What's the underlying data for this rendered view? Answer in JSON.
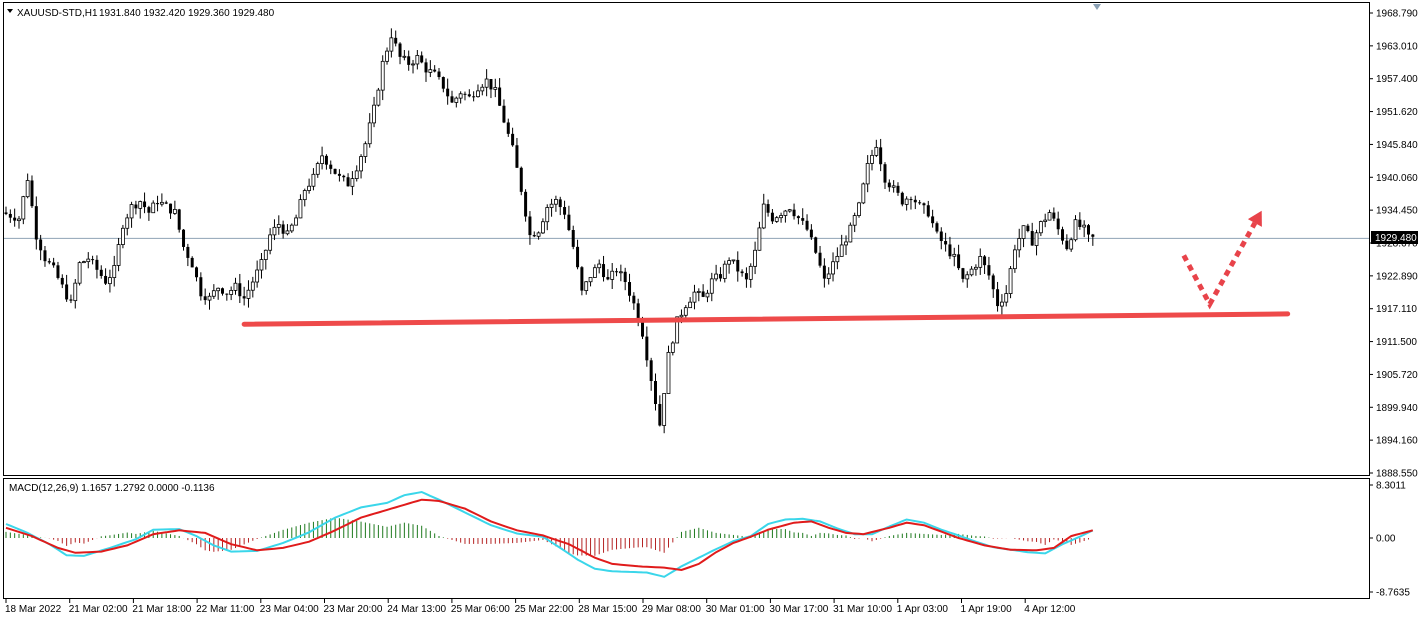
{
  "header": {
    "symbol": "XAUUSD-STD,H1",
    "ohlc": "1931.840 1932.420 1929.360 1929.480"
  },
  "macd_header": "MACD(12,26,9) 1.1657 1.2792 0.0000 -0.1136",
  "current_price_label": "1929.480",
  "chart_data": {
    "type": "candlestick",
    "price_axis": {
      "ticks": [
        "1968.790",
        "1963.010",
        "1957.400",
        "1951.620",
        "1945.840",
        "1940.060",
        "1934.450",
        "1928.670",
        "1922.890",
        "1917.110",
        "1911.500",
        "1905.720",
        "1899.940",
        "1894.160",
        "1888.550"
      ],
      "range": [
        1888.55,
        1968.79
      ],
      "current": 1929.48
    },
    "macd_axis": {
      "ticks": [
        "8.3011",
        "0.00",
        "-8.7635"
      ],
      "range": [
        -8.7635,
        8.3011
      ]
    },
    "time_axis": [
      "18 Mar 2022",
      "21 Mar 02:00",
      "21 Mar 18:00",
      "22 Mar 11:00",
      "23 Mar 04:00",
      "23 Mar 20:00",
      "24 Mar 13:00",
      "25 Mar 06:00",
      "25 Mar 22:00",
      "28 Mar 15:00",
      "29 Mar 08:00",
      "30 Mar 01:00",
      "30 Mar 17:00",
      "31 Mar 10:00",
      "1 Apr 03:00",
      "1 Apr 19:00",
      "4 Apr 12:00"
    ],
    "price_path": [
      [
        0,
        1934
      ],
      [
        4,
        1933
      ],
      [
        6,
        1940
      ],
      [
        8,
        1930
      ],
      [
        10,
        1926
      ],
      [
        12,
        1924
      ],
      [
        14,
        1921
      ],
      [
        16,
        1918
      ],
      [
        18,
        1925
      ],
      [
        20,
        1926
      ],
      [
        22,
        1924
      ],
      [
        24,
        1922
      ],
      [
        26,
        1924
      ],
      [
        28,
        1932
      ],
      [
        30,
        1935
      ],
      [
        32,
        1936
      ],
      [
        34,
        1934
      ],
      [
        36,
        1936
      ],
      [
        38,
        1935
      ],
      [
        40,
        1934
      ],
      [
        42,
        1928
      ],
      [
        44,
        1925
      ],
      [
        46,
        1920
      ],
      [
        48,
        1919
      ],
      [
        50,
        1921
      ],
      [
        52,
        1920
      ],
      [
        54,
        1921
      ],
      [
        56,
        1919
      ],
      [
        58,
        1922
      ],
      [
        60,
        1925
      ],
      [
        62,
        1930
      ],
      [
        64,
        1932
      ],
      [
        66,
        1930
      ],
      [
        68,
        1933
      ],
      [
        70,
        1938
      ],
      [
        72,
        1940
      ],
      [
        74,
        1944
      ],
      [
        76,
        1942
      ],
      [
        78,
        1940
      ],
      [
        80,
        1939
      ],
      [
        82,
        1942
      ],
      [
        84,
        1946
      ],
      [
        86,
        1952
      ],
      [
        88,
        1960
      ],
      [
        90,
        1965
      ],
      [
        92,
        1961
      ],
      [
        94,
        1960
      ],
      [
        96,
        1961
      ],
      [
        98,
        1959
      ],
      [
        100,
        1958
      ],
      [
        102,
        1956
      ],
      [
        104,
        1953
      ],
      [
        106,
        1955
      ],
      [
        108,
        1954
      ],
      [
        110,
        1956
      ],
      [
        112,
        1957
      ],
      [
        114,
        1955
      ],
      [
        116,
        1950
      ],
      [
        118,
        1945
      ],
      [
        120,
        1938
      ],
      [
        122,
        1930
      ],
      [
        124,
        1931
      ],
      [
        126,
        1935
      ],
      [
        128,
        1936
      ],
      [
        130,
        1934
      ],
      [
        132,
        1928
      ],
      [
        134,
        1920
      ],
      [
        136,
        1923
      ],
      [
        138,
        1925
      ],
      [
        140,
        1922
      ],
      [
        142,
        1924
      ],
      [
        144,
        1922
      ],
      [
        146,
        1918
      ],
      [
        148,
        1913
      ],
      [
        150,
        1905
      ],
      [
        152,
        1897
      ],
      [
        154,
        1909
      ],
      [
        156,
        1915
      ],
      [
        158,
        1918
      ],
      [
        160,
        1920
      ],
      [
        162,
        1919
      ],
      [
        164,
        1922
      ],
      [
        166,
        1923
      ],
      [
        168,
        1926
      ],
      [
        170,
        1924
      ],
      [
        172,
        1922
      ],
      [
        174,
        1927
      ],
      [
        176,
        1935
      ],
      [
        178,
        1933
      ],
      [
        180,
        1934
      ],
      [
        182,
        1935
      ],
      [
        184,
        1933
      ],
      [
        186,
        1931
      ],
      [
        188,
        1927
      ],
      [
        190,
        1922
      ],
      [
        192,
        1925
      ],
      [
        194,
        1928
      ],
      [
        196,
        1931
      ],
      [
        198,
        1935
      ],
      [
        200,
        1942
      ],
      [
        202,
        1946
      ],
      [
        204,
        1940
      ],
      [
        206,
        1938
      ],
      [
        208,
        1936
      ],
      [
        210,
        1937
      ],
      [
        212,
        1935
      ],
      [
        214,
        1934
      ],
      [
        216,
        1930
      ],
      [
        218,
        1928
      ],
      [
        220,
        1926
      ],
      [
        222,
        1922
      ],
      [
        224,
        1924
      ],
      [
        226,
        1926
      ],
      [
        228,
        1923
      ],
      [
        230,
        1918
      ],
      [
        232,
        1920
      ],
      [
        234,
        1928
      ],
      [
        236,
        1931
      ],
      [
        238,
        1929
      ],
      [
        240,
        1932
      ],
      [
        242,
        1934
      ],
      [
        244,
        1931
      ],
      [
        246,
        1928
      ],
      [
        248,
        1932
      ],
      [
        250,
        1931
      ],
      [
        251,
        1929.48
      ]
    ],
    "macd_path": [
      [
        0,
        2.2
      ],
      [
        5,
        0.8
      ],
      [
        10,
        -1.0
      ],
      [
        14,
        -2.8
      ],
      [
        18,
        -2.9
      ],
      [
        24,
        -1.6
      ],
      [
        30,
        -0.2
      ],
      [
        34,
        1.3
      ],
      [
        40,
        1.4
      ],
      [
        44,
        0.3
      ],
      [
        48,
        -1.2
      ],
      [
        52,
        -2.2
      ],
      [
        58,
        -2.1
      ],
      [
        64,
        -0.8
      ],
      [
        70,
        0.9
      ],
      [
        76,
        3.2
      ],
      [
        82,
        4.8
      ],
      [
        88,
        5.5
      ],
      [
        92,
        6.7
      ],
      [
        96,
        7.2
      ],
      [
        100,
        6.0
      ],
      [
        106,
        4.0
      ],
      [
        112,
        2.0
      ],
      [
        118,
        0.7
      ],
      [
        124,
        0.2
      ],
      [
        128,
        -1.6
      ],
      [
        132,
        -3.5
      ],
      [
        136,
        -5.0
      ],
      [
        140,
        -5.4
      ],
      [
        144,
        -5.5
      ],
      [
        148,
        -5.6
      ],
      [
        152,
        -6.3
      ],
      [
        156,
        -4.6
      ],
      [
        160,
        -3.2
      ],
      [
        164,
        -1.8
      ],
      [
        168,
        -0.5
      ],
      [
        172,
        0.3
      ],
      [
        176,
        2.2
      ],
      [
        180,
        2.9
      ],
      [
        184,
        3.0
      ],
      [
        188,
        2.6
      ],
      [
        192,
        1.5
      ],
      [
        196,
        0.6
      ],
      [
        200,
        0.6
      ],
      [
        204,
        1.8
      ],
      [
        208,
        2.9
      ],
      [
        212,
        2.4
      ],
      [
        216,
        1.3
      ],
      [
        220,
        0.4
      ],
      [
        224,
        -0.6
      ],
      [
        228,
        -1.5
      ],
      [
        232,
        -1.9
      ],
      [
        236,
        -2.3
      ],
      [
        240,
        -2.5
      ],
      [
        244,
        -1.0
      ],
      [
        248,
        0.2
      ],
      [
        251,
        1.2
      ]
    ],
    "signal_path": [
      [
        0,
        1.6
      ],
      [
        6,
        0.3
      ],
      [
        12,
        -1.6
      ],
      [
        16,
        -2.4
      ],
      [
        22,
        -2.2
      ],
      [
        28,
        -1.2
      ],
      [
        34,
        0.6
      ],
      [
        40,
        1.2
      ],
      [
        46,
        0.8
      ],
      [
        52,
        -1.0
      ],
      [
        58,
        -2.0
      ],
      [
        64,
        -1.6
      ],
      [
        70,
        -0.6
      ],
      [
        76,
        1.2
      ],
      [
        82,
        3.2
      ],
      [
        86,
        4.0
      ],
      [
        90,
        4.8
      ],
      [
        96,
        6.0
      ],
      [
        100,
        5.8
      ],
      [
        106,
        4.6
      ],
      [
        112,
        2.6
      ],
      [
        118,
        1.2
      ],
      [
        124,
        0.4
      ],
      [
        130,
        -1.0
      ],
      [
        136,
        -3.2
      ],
      [
        140,
        -4.2
      ],
      [
        146,
        -4.6
      ],
      [
        152,
        -4.8
      ],
      [
        156,
        -5.2
      ],
      [
        160,
        -4.2
      ],
      [
        164,
        -2.3
      ],
      [
        168,
        -0.8
      ],
      [
        172,
        0.2
      ],
      [
        176,
        1.3
      ],
      [
        182,
        2.4
      ],
      [
        186,
        2.6
      ],
      [
        190,
        1.6
      ],
      [
        194,
        0.8
      ],
      [
        198,
        0.6
      ],
      [
        204,
        1.6
      ],
      [
        208,
        2.4
      ],
      [
        212,
        2.0
      ],
      [
        216,
        1.0
      ],
      [
        220,
        0.0
      ],
      [
        226,
        -1.2
      ],
      [
        232,
        -1.9
      ],
      [
        238,
        -2.0
      ],
      [
        242,
        -1.6
      ],
      [
        246,
        0.3
      ],
      [
        251,
        1.2
      ]
    ],
    "annotations": {
      "support_line": {
        "from": [
          55,
          1914.5
        ],
        "to": [
          296,
          1916.3
        ]
      },
      "projection_arrow": {
        "from": [
          272,
          1926.5
        ],
        "via": [
          278,
          1918.0
        ],
        "to": [
          290,
          1934.3
        ]
      }
    }
  }
}
